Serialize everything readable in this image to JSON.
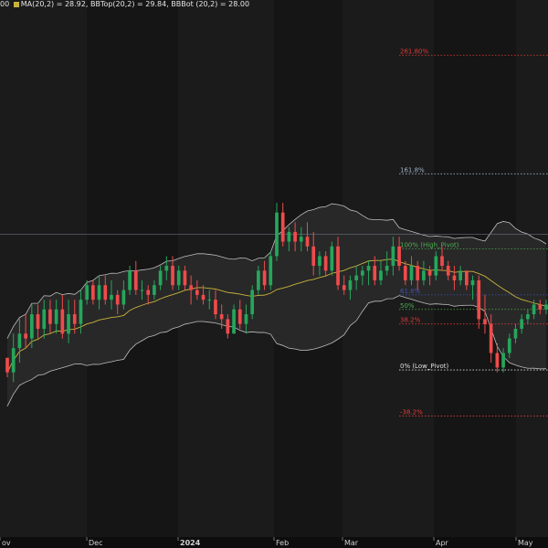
{
  "legend": {
    "prefix": "00",
    "ma": "MA(20,2) = 28.92",
    "bbtop": "BBTop(20,2) = 29.84",
    "bbbot": "BBBot (20,2) = 28.00"
  },
  "chart_data": {
    "type": "candlestick",
    "title": "",
    "x_ticks": [
      "ov",
      "Dec",
      "2024",
      "Feb",
      "Mar",
      "Apr",
      "May"
    ],
    "y_range": [
      23.7,
      34.6
    ],
    "colors": {
      "up": "#26a65b",
      "down": "#ef4b4b",
      "ma": "#c8b43c",
      "band_fill": "#2a2a2a",
      "band_line": "#bdbdbd",
      "fib_261": "#e53935",
      "fib_161": "#9fb3c8",
      "fib_100": "#4caf50",
      "fib_50": "#4caf50",
      "fib_38": "#e53935",
      "fib_0": "#e0e0e0",
      "fib_neg38": "#e53935",
      "fib_618": "#3f51b5"
    },
    "fib_levels": [
      {
        "label": "261.80%",
        "price": 33.65
      },
      {
        "label": "161.8%",
        "price": 31.2
      },
      {
        "label": "100% (High_Pivot)",
        "price": 29.65
      },
      {
        "label": "61.8%",
        "price": 28.7
      },
      {
        "label": "50%",
        "price": 28.4
      },
      {
        "label": "38.2%",
        "price": 28.1
      },
      {
        "label": "0% (Low_Pivot)",
        "price": 27.15
      },
      {
        "label": "-38.2%",
        "price": 26.2
      }
    ],
    "reference_line": 29.95,
    "candles": [
      [
        27.4,
        27.4,
        27.0,
        27.1
      ],
      [
        27.1,
        27.9,
        26.9,
        27.6
      ],
      [
        27.6,
        28.2,
        27.3,
        27.9
      ],
      [
        27.9,
        28.3,
        27.6,
        27.8
      ],
      [
        27.8,
        28.5,
        27.6,
        28.3
      ],
      [
        28.3,
        28.5,
        27.8,
        28.0
      ],
      [
        28.0,
        28.6,
        27.8,
        28.4
      ],
      [
        28.4,
        28.6,
        27.9,
        28.1
      ],
      [
        28.1,
        28.6,
        27.9,
        28.4
      ],
      [
        28.4,
        28.7,
        27.8,
        27.9
      ],
      [
        27.9,
        28.6,
        27.7,
        28.3
      ],
      [
        28.3,
        28.6,
        27.9,
        28.1
      ],
      [
        28.1,
        28.8,
        27.9,
        28.6
      ],
      [
        28.6,
        29.0,
        28.5,
        28.9
      ],
      [
        28.9,
        29.0,
        28.5,
        28.6
      ],
      [
        28.6,
        29.1,
        28.4,
        28.9
      ],
      [
        28.9,
        29.1,
        28.5,
        28.6
      ],
      [
        28.6,
        29.0,
        28.4,
        28.7
      ],
      [
        28.7,
        28.8,
        28.3,
        28.5
      ],
      [
        28.5,
        29.0,
        28.4,
        28.8
      ],
      [
        28.8,
        29.3,
        28.7,
        29.2
      ],
      [
        29.2,
        29.4,
        28.7,
        28.8
      ],
      [
        28.8,
        29.0,
        28.6,
        28.8
      ],
      [
        28.8,
        28.9,
        28.5,
        28.7
      ],
      [
        28.7,
        29.0,
        28.6,
        28.9
      ],
      [
        28.9,
        29.3,
        28.8,
        29.2
      ],
      [
        29.2,
        29.5,
        29.0,
        29.3
      ],
      [
        29.3,
        29.5,
        28.8,
        28.9
      ],
      [
        28.9,
        29.3,
        28.8,
        29.2
      ],
      [
        29.2,
        29.3,
        28.8,
        28.9
      ],
      [
        28.9,
        29.1,
        28.5,
        28.8
      ],
      [
        28.8,
        29.0,
        28.6,
        28.7
      ],
      [
        28.7,
        28.9,
        28.5,
        28.6
      ],
      [
        28.6,
        28.8,
        28.4,
        28.6
      ],
      [
        28.6,
        28.8,
        28.2,
        28.3
      ],
      [
        28.3,
        28.5,
        28.0,
        28.2
      ],
      [
        28.2,
        28.3,
        27.8,
        27.9
      ],
      [
        27.9,
        28.5,
        27.9,
        28.4
      ],
      [
        28.4,
        28.6,
        28.0,
        28.1
      ],
      [
        28.1,
        28.5,
        27.9,
        28.3
      ],
      [
        28.3,
        28.9,
        28.2,
        28.8
      ],
      [
        28.8,
        29.3,
        28.7,
        29.2
      ],
      [
        29.2,
        29.4,
        28.8,
        28.9
      ],
      [
        28.9,
        29.6,
        28.8,
        29.5
      ],
      [
        29.5,
        30.6,
        29.4,
        30.4
      ],
      [
        30.4,
        30.6,
        29.7,
        29.8
      ],
      [
        29.8,
        30.1,
        29.6,
        30.0
      ],
      [
        30.0,
        30.2,
        29.6,
        29.8
      ],
      [
        29.8,
        30.1,
        29.6,
        29.9
      ],
      [
        29.9,
        30.2,
        29.6,
        29.7
      ],
      [
        29.7,
        30.0,
        29.1,
        29.3
      ],
      [
        29.3,
        29.6,
        29.1,
        29.5
      ],
      [
        29.5,
        29.6,
        29.1,
        29.2
      ],
      [
        29.2,
        29.8,
        29.1,
        29.7
      ],
      [
        29.7,
        29.9,
        28.8,
        28.9
      ],
      [
        28.9,
        29.1,
        28.7,
        28.8
      ],
      [
        28.8,
        29.1,
        28.6,
        29.0
      ],
      [
        29.0,
        29.3,
        28.8,
        29.1
      ],
      [
        29.1,
        29.3,
        28.9,
        29.2
      ],
      [
        29.2,
        29.4,
        28.9,
        29.3
      ],
      [
        29.3,
        29.5,
        28.9,
        29.0
      ],
      [
        29.0,
        29.4,
        28.9,
        29.2
      ],
      [
        29.2,
        29.6,
        29.1,
        29.3
      ],
      [
        29.3,
        29.9,
        29.1,
        29.7
      ],
      [
        29.7,
        29.9,
        29.2,
        29.3
      ],
      [
        29.3,
        29.4,
        28.9,
        29.0
      ],
      [
        29.0,
        29.5,
        28.9,
        29.3
      ],
      [
        29.3,
        29.4,
        28.8,
        29.0
      ],
      [
        29.0,
        29.4,
        28.9,
        29.2
      ],
      [
        29.2,
        29.3,
        28.9,
        29.1
      ],
      [
        29.1,
        29.6,
        29.0,
        29.5
      ],
      [
        29.5,
        29.7,
        29.2,
        29.3
      ],
      [
        29.3,
        29.4,
        29.0,
        29.1
      ],
      [
        29.1,
        29.3,
        28.8,
        29.0
      ],
      [
        29.0,
        29.3,
        28.9,
        29.2
      ],
      [
        29.2,
        29.2,
        28.8,
        28.9
      ],
      [
        28.9,
        29.1,
        28.6,
        29.0
      ],
      [
        29.0,
        29.1,
        28.0,
        28.2
      ],
      [
        28.2,
        28.7,
        27.9,
        28.1
      ],
      [
        28.1,
        28.3,
        27.3,
        27.5
      ],
      [
        27.5,
        27.7,
        27.1,
        27.2
      ],
      [
        27.2,
        27.6,
        27.1,
        27.5
      ],
      [
        27.5,
        27.9,
        27.4,
        27.8
      ],
      [
        27.8,
        28.1,
        27.7,
        28.0
      ],
      [
        28.0,
        28.3,
        27.9,
        28.2
      ],
      [
        28.2,
        28.4,
        28.1,
        28.3
      ],
      [
        28.3,
        28.6,
        28.2,
        28.5
      ],
      [
        28.5,
        28.6,
        28.3,
        28.4
      ],
      [
        28.4,
        28.6,
        28.3,
        28.5
      ]
    ]
  }
}
